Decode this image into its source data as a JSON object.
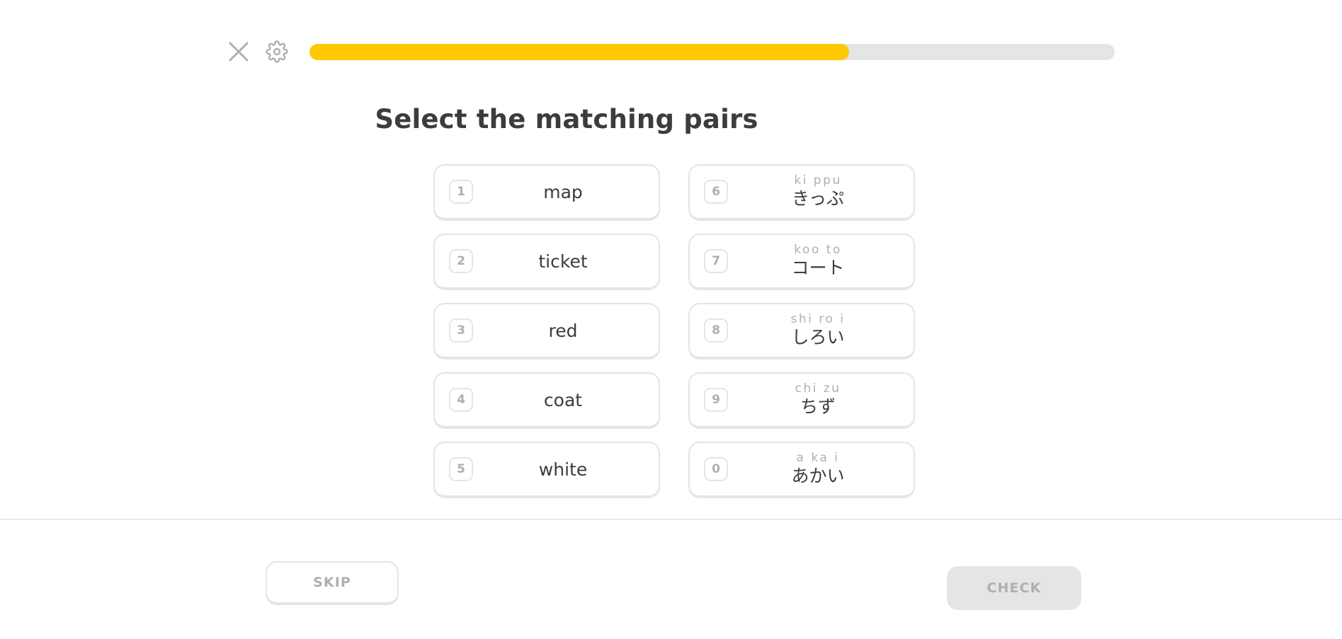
{
  "header": {
    "close_icon": "close-icon",
    "settings_icon": "gear-icon",
    "progress": {
      "percent": 67,
      "fill_color": "#ffc800",
      "track_color": "#e5e5e5"
    }
  },
  "main": {
    "title": "Select the matching pairs",
    "left_column": [
      {
        "number": "1",
        "text": "map"
      },
      {
        "number": "2",
        "text": "ticket"
      },
      {
        "number": "3",
        "text": "red"
      },
      {
        "number": "4",
        "text": "coat"
      },
      {
        "number": "5",
        "text": "white"
      }
    ],
    "right_column": [
      {
        "number": "6",
        "romaji": "ki ppu",
        "text": "きっぷ"
      },
      {
        "number": "7",
        "romaji": "koo to",
        "text": "コート"
      },
      {
        "number": "8",
        "romaji": "shi ro i",
        "text": "しろい"
      },
      {
        "number": "9",
        "romaji": "chi zu",
        "text": "ちず"
      },
      {
        "number": "0",
        "romaji": "a ka i",
        "text": "あかい"
      }
    ]
  },
  "footer": {
    "skip_label": "SKIP",
    "check_label": "CHECK"
  }
}
